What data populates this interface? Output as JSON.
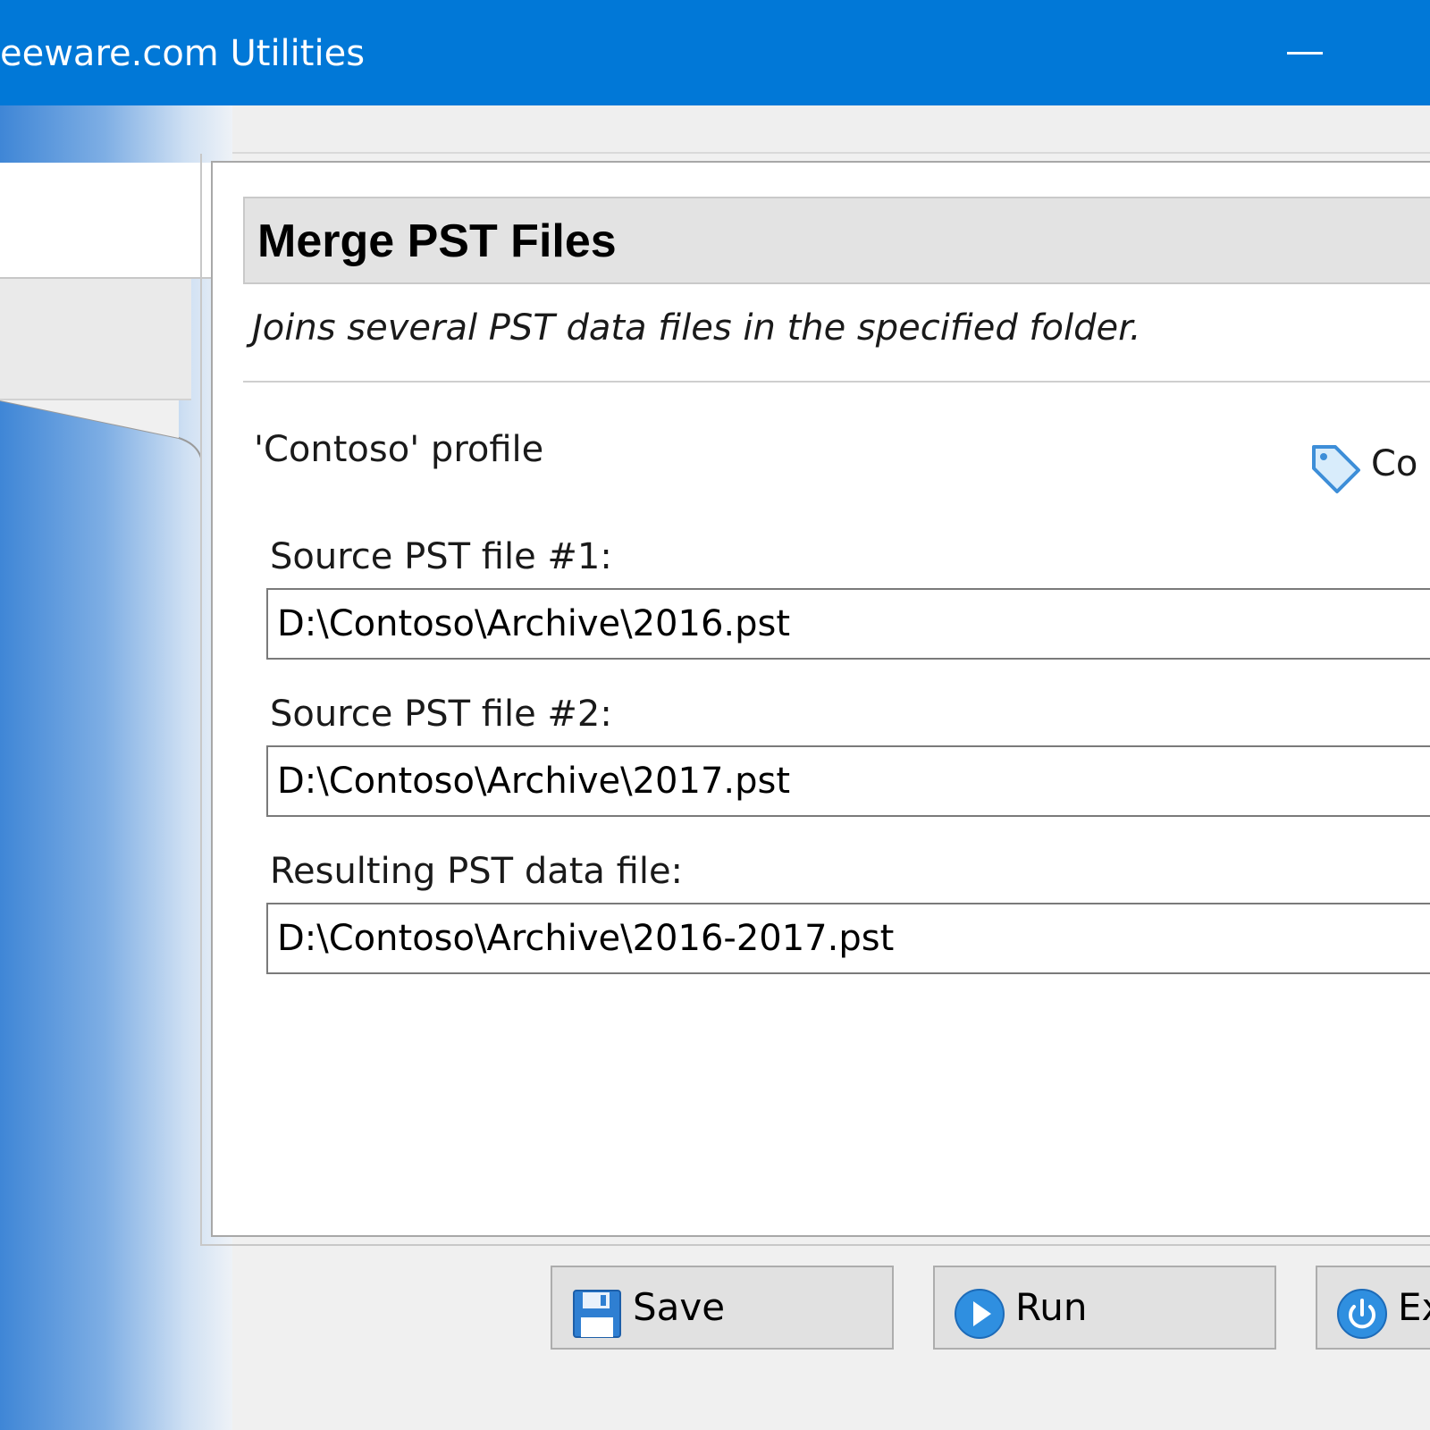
{
  "window": {
    "title": "eeware.com Utilities"
  },
  "header": {
    "title": "Merge PST Files",
    "description": "Joins several PST data files in the specified folder."
  },
  "profile": {
    "label": "'Contoso' profile",
    "tag_link_label": "Co"
  },
  "fields": [
    {
      "label": "Source PST file #1:",
      "value": "D:\\Contoso\\Archive\\2016.pst"
    },
    {
      "label": "Source PST file #2:",
      "value": "D:\\Contoso\\Archive\\2017.pst"
    },
    {
      "label": "Resulting PST data file:",
      "value": "D:\\Contoso\\Archive\\2016-2017.pst"
    }
  ],
  "buttons": {
    "save": "Save",
    "run": "Run",
    "exit": "Ex"
  },
  "colors": {
    "titlebar": "#0178d7",
    "window_bg": "#f0f0f0",
    "accent_icon": "#2f8fe0"
  },
  "icons": {
    "minimize": "minimize-icon",
    "tag": "tag-icon",
    "save": "floppy-disk-icon",
    "run": "play-icon",
    "exit": "power-icon"
  }
}
